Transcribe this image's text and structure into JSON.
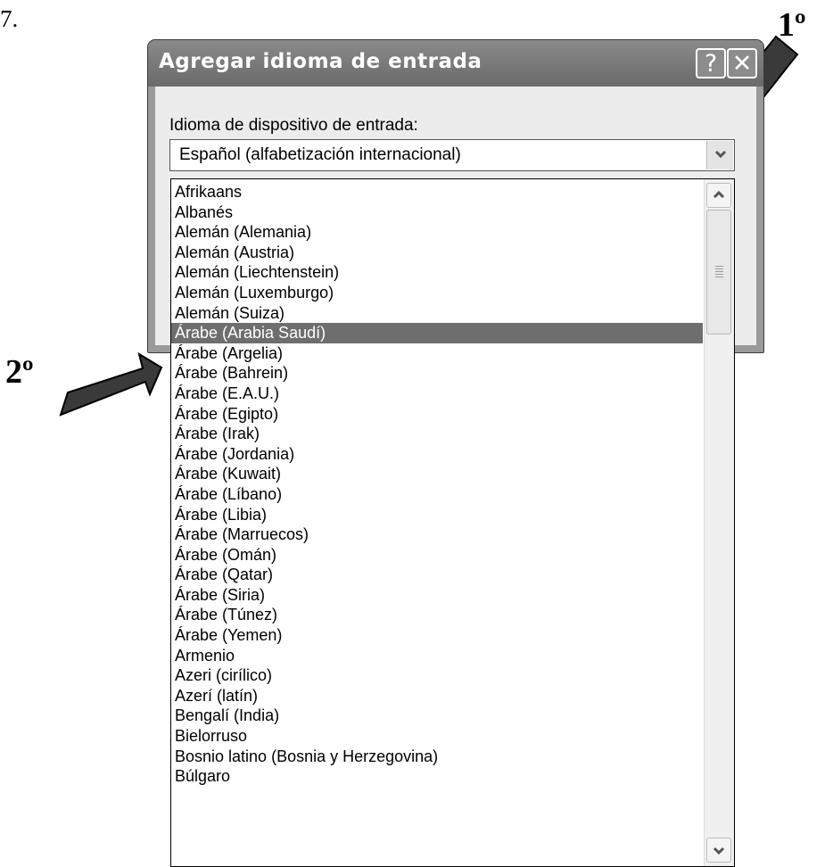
{
  "document": {
    "fragment": "7.",
    "step1_label": "1º",
    "step2_label": "2º"
  },
  "dialog": {
    "title": "Agregar idioma de entrada",
    "help_icon": "help-icon",
    "close_icon": "close-icon",
    "field_label": "Idioma de dispositivo de entrada:",
    "selected_value": "Español (alfabetización internacional)",
    "dropdown_icon": "chevron-down-icon"
  },
  "dropdown": {
    "items": [
      "Afrikaans",
      "Albanés",
      "Alemán (Alemania)",
      "Alemán (Austria)",
      "Alemán (Liechtenstein)",
      "Alemán (Luxemburgo)",
      "Alemán (Suiza)",
      "Árabe (Arabia Saudí)",
      "Árabe (Argelia)",
      "Árabe (Bahrein)",
      "Árabe (E.A.U.)",
      "Árabe (Egipto)",
      "Árabe (Irak)",
      "Árabe (Jordania)",
      "Árabe (Kuwait)",
      "Árabe (Líbano)",
      "Árabe (Libia)",
      "Árabe (Marruecos)",
      "Árabe (Omán)",
      "Árabe (Qatar)",
      "Árabe (Siria)",
      "Árabe (Túnez)",
      "Árabe (Yemen)",
      "Armenio",
      "Azeri (cirílico)",
      "Azerí (latín)",
      "Bengalí (India)",
      "Bielorruso",
      "Bosnio latino (Bosnia y Herzegovina)",
      "Búlgaro"
    ],
    "highlighted_item": "Árabe (Arabia Saudí)"
  },
  "colors": {
    "titlebar": "#7a7a7a",
    "highlight": "#6e6e6e",
    "arrow": "#3a3a3a"
  }
}
